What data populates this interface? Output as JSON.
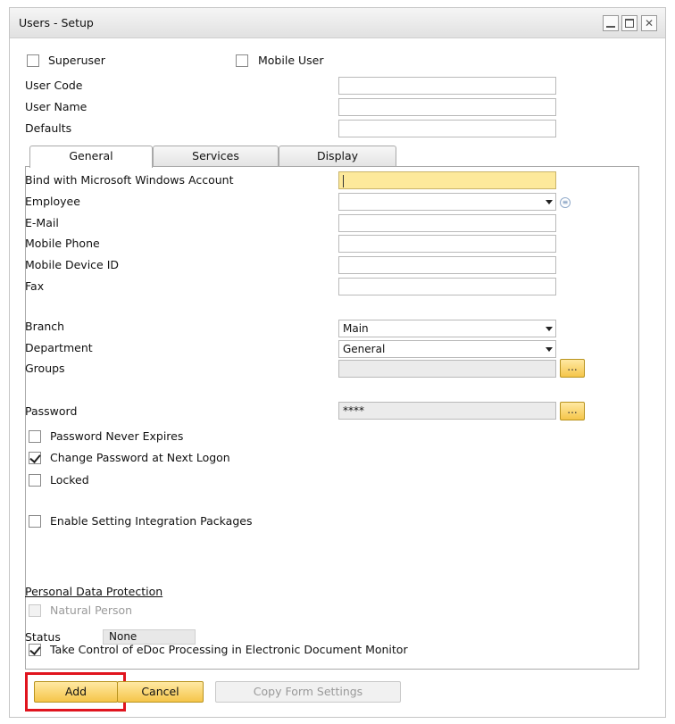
{
  "window": {
    "title": "Users - Setup"
  },
  "header": {
    "superuser": {
      "label": "Superuser",
      "checked": false
    },
    "mobile_user": {
      "label": "Mobile User",
      "checked": false
    },
    "user_code": {
      "label": "User Code",
      "value": ""
    },
    "user_name": {
      "label": "User Name",
      "value": ""
    },
    "defaults": {
      "label": "Defaults",
      "value": ""
    }
  },
  "tabs": [
    "General",
    "Services",
    "Display"
  ],
  "general": {
    "bind_windows": {
      "label": "Bind with Microsoft Windows Account",
      "value": ""
    },
    "employee": {
      "label": "Employee",
      "value": ""
    },
    "email": {
      "label": "E-Mail",
      "value": ""
    },
    "mobile_phone": {
      "label": "Mobile Phone",
      "value": ""
    },
    "mobile_device": {
      "label": "Mobile Device ID",
      "value": ""
    },
    "fax": {
      "label": "Fax",
      "value": ""
    },
    "branch": {
      "label": "Branch",
      "value": "Main"
    },
    "department": {
      "label": "Department",
      "value": "General"
    },
    "groups": {
      "label": "Groups",
      "value": "",
      "button": "..."
    },
    "password": {
      "label": "Password",
      "value": "****",
      "button": "..."
    },
    "password_never_expires": {
      "label": "Password Never Expires",
      "checked": false
    },
    "change_password": {
      "label": "Change Password at Next Logon",
      "checked": true
    },
    "locked": {
      "label": "Locked",
      "checked": false
    },
    "enable_integration": {
      "label": "Enable Setting Integration Packages",
      "checked": false
    },
    "pdp": {
      "heading": "Personal Data Protection",
      "natural_person": {
        "label": "Natural Person",
        "checked": false,
        "disabled": true
      },
      "status_label": "Status",
      "status_value": "None"
    },
    "edoc": {
      "label": "Take Control of eDoc Processing in Electronic Document Monitor",
      "checked": true
    }
  },
  "footer": {
    "add": "Add",
    "cancel": "Cancel",
    "copy_form_settings": "Copy Form Settings"
  },
  "icons": {
    "info": "list-info-icon",
    "dropdown": "chevron-down-icon"
  },
  "colors": {
    "accent": "#f5c54a",
    "highlight": "#e0141e",
    "active_field": "#fde99b"
  }
}
